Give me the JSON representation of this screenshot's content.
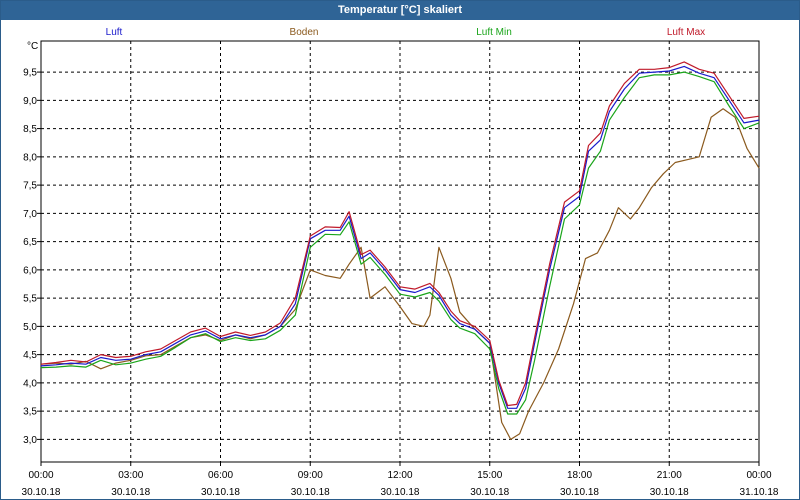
{
  "window": {
    "title": "Temperatur [°C] skaliert"
  },
  "chart_data": {
    "type": "line",
    "title": "Temperatur [°C] skaliert",
    "ylabel": "°C",
    "xlabel": "",
    "ylim": [
      2.6,
      10.05
    ],
    "yticks": [
      3.0,
      3.5,
      4.0,
      4.5,
      5.0,
      5.5,
      6.0,
      6.5,
      7.0,
      7.5,
      8.0,
      8.5,
      9.0,
      9.5
    ],
    "ytick_labels": [
      "3,0",
      "3,5",
      "4,0",
      "4,5",
      "5,0",
      "5,5",
      "6,0",
      "6,5",
      "7,0",
      "7,5",
      "8,0",
      "8,5",
      "9,0",
      "9,5"
    ],
    "xlim": [
      0,
      24
    ],
    "xticks": [
      0,
      3,
      6,
      9,
      12,
      15,
      18,
      21,
      24
    ],
    "xtick_labels": [
      [
        "00:00",
        "30.10.18"
      ],
      [
        "03:00",
        "30.10.18"
      ],
      [
        "06:00",
        "30.10.18"
      ],
      [
        "09:00",
        "30.10.18"
      ],
      [
        "12:00",
        "30.10.18"
      ],
      [
        "15:00",
        "30.10.18"
      ],
      [
        "18:00",
        "30.10.18"
      ],
      [
        "21:00",
        "30.10.18"
      ],
      [
        "00:00",
        "31.10.18"
      ]
    ],
    "grid": true,
    "legend": "top",
    "series": [
      {
        "name": "Luft",
        "color": "#1a1acc",
        "x": [
          0,
          0.5,
          1,
          1.5,
          2,
          2.5,
          3,
          3.5,
          4,
          4.5,
          5,
          5.5,
          6,
          6.5,
          7,
          7.5,
          8,
          8.5,
          9,
          9.5,
          10,
          10.3,
          10.7,
          11,
          11.5,
          12,
          12.5,
          13,
          13.3,
          13.7,
          14,
          14.5,
          15,
          15.3,
          15.6,
          15.9,
          16.2,
          16.5,
          17,
          17.5,
          18,
          18.3,
          18.7,
          19,
          19.5,
          20,
          20.5,
          21,
          21.5,
          22,
          22.5,
          23,
          23.5,
          24
        ],
        "y": [
          4.3,
          4.32,
          4.35,
          4.33,
          4.45,
          4.4,
          4.42,
          4.5,
          4.55,
          4.7,
          4.85,
          4.92,
          4.78,
          4.85,
          4.8,
          4.85,
          5.0,
          5.4,
          6.55,
          6.7,
          6.7,
          6.95,
          6.2,
          6.3,
          6.0,
          5.65,
          5.6,
          5.7,
          5.55,
          5.2,
          5.05,
          4.95,
          4.7,
          4.0,
          3.55,
          3.55,
          3.9,
          4.7,
          6.0,
          7.1,
          7.3,
          8.1,
          8.3,
          8.8,
          9.2,
          9.48,
          9.5,
          9.52,
          9.6,
          9.48,
          9.4,
          9.0,
          8.6,
          8.65
        ]
      },
      {
        "name": "Boden",
        "color": "#8b5a1e",
        "x": [
          0,
          0.5,
          1,
          1.5,
          2,
          2.5,
          3,
          3.5,
          4,
          4.5,
          5,
          5.5,
          6,
          6.5,
          7,
          7.5,
          8,
          8.5,
          9,
          9.5,
          10,
          10.3,
          10.7,
          11,
          11.5,
          12,
          12.4,
          12.8,
          13,
          13.3,
          13.7,
          14,
          14.5,
          15,
          15.4,
          15.7,
          16,
          16.3,
          16.8,
          17.3,
          17.8,
          18.2,
          18.6,
          19,
          19.3,
          19.7,
          20,
          20.4,
          20.8,
          21.2,
          21.6,
          22,
          22.4,
          22.8,
          23.2,
          23.6,
          24
        ],
        "y": [
          4.33,
          4.35,
          4.33,
          4.38,
          4.25,
          4.35,
          4.4,
          4.48,
          4.5,
          4.65,
          4.8,
          4.85,
          4.75,
          4.85,
          4.78,
          4.85,
          5.0,
          5.3,
          6.0,
          5.9,
          5.85,
          6.1,
          6.4,
          5.5,
          5.7,
          5.35,
          5.05,
          5.0,
          5.2,
          6.4,
          5.85,
          5.25,
          4.95,
          4.7,
          3.3,
          3.0,
          3.1,
          3.5,
          4.0,
          4.6,
          5.4,
          6.2,
          6.3,
          6.7,
          7.1,
          6.9,
          7.1,
          7.45,
          7.7,
          7.9,
          7.95,
          8.0,
          8.7,
          8.85,
          8.7,
          8.15,
          7.8
        ]
      },
      {
        "name": "Luft Min",
        "color": "#1aa51a",
        "x": [
          0,
          0.5,
          1,
          1.5,
          2,
          2.5,
          3,
          3.5,
          4,
          4.5,
          5,
          5.5,
          6,
          6.5,
          7,
          7.5,
          8,
          8.5,
          9,
          9.5,
          10,
          10.3,
          10.7,
          11,
          11.5,
          12,
          12.5,
          13,
          13.3,
          13.7,
          14,
          14.5,
          15,
          15.3,
          15.6,
          15.9,
          16.2,
          16.5,
          17,
          17.5,
          18,
          18.3,
          18.7,
          19,
          19.5,
          20,
          20.5,
          21,
          21.5,
          22,
          22.5,
          23,
          23.5,
          24
        ],
        "y": [
          4.27,
          4.28,
          4.3,
          4.28,
          4.4,
          4.32,
          4.35,
          4.42,
          4.47,
          4.63,
          4.8,
          4.87,
          4.73,
          4.8,
          4.75,
          4.78,
          4.93,
          5.2,
          6.4,
          6.63,
          6.62,
          6.85,
          6.1,
          6.22,
          5.92,
          5.57,
          5.52,
          5.6,
          5.45,
          5.12,
          4.97,
          4.87,
          4.6,
          3.9,
          3.45,
          3.45,
          3.7,
          4.4,
          5.7,
          6.9,
          7.15,
          7.8,
          8.1,
          8.65,
          9.05,
          9.4,
          9.45,
          9.45,
          9.5,
          9.42,
          9.33,
          8.9,
          8.5,
          8.6
        ]
      },
      {
        "name": "Luft Max",
        "color": "#c01a2a",
        "x": [
          0,
          0.5,
          1,
          1.5,
          2,
          2.5,
          3,
          3.5,
          4,
          4.5,
          5,
          5.5,
          6,
          6.5,
          7,
          7.5,
          8,
          8.5,
          9,
          9.5,
          10,
          10.3,
          10.7,
          11,
          11.5,
          12,
          12.5,
          13,
          13.3,
          13.7,
          14,
          14.5,
          15,
          15.3,
          15.6,
          15.9,
          16.2,
          16.5,
          17,
          17.5,
          18,
          18.3,
          18.7,
          19,
          19.5,
          20,
          20.5,
          21,
          21.5,
          22,
          22.5,
          23,
          23.5,
          24
        ],
        "y": [
          4.33,
          4.36,
          4.4,
          4.37,
          4.5,
          4.45,
          4.47,
          4.55,
          4.6,
          4.75,
          4.9,
          4.97,
          4.82,
          4.9,
          4.84,
          4.9,
          5.06,
          5.5,
          6.6,
          6.76,
          6.75,
          7.03,
          6.27,
          6.35,
          6.05,
          5.7,
          5.66,
          5.76,
          5.6,
          5.27,
          5.1,
          5.0,
          4.75,
          4.05,
          3.6,
          3.62,
          4.0,
          4.8,
          6.1,
          7.2,
          7.4,
          8.2,
          8.42,
          8.9,
          9.3,
          9.55,
          9.55,
          9.58,
          9.68,
          9.55,
          9.48,
          9.08,
          8.68,
          8.72
        ]
      }
    ]
  }
}
